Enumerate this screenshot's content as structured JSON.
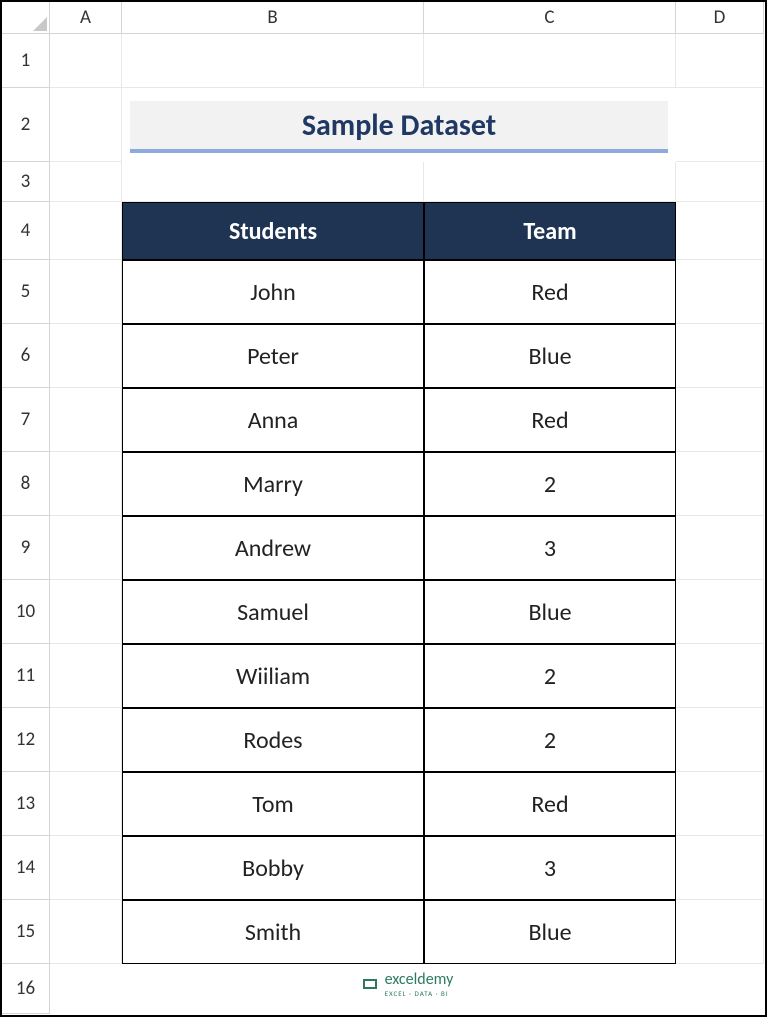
{
  "columns": [
    "A",
    "B",
    "C",
    "D"
  ],
  "rows": [
    "1",
    "2",
    "3",
    "4",
    "5",
    "6",
    "7",
    "8",
    "9",
    "10",
    "11",
    "12",
    "13",
    "14",
    "15",
    "16"
  ],
  "title": "Sample Dataset",
  "table": {
    "headers": [
      "Students",
      "Team"
    ],
    "data": [
      {
        "student": "John",
        "team": "Red"
      },
      {
        "student": "Peter",
        "team": "Blue"
      },
      {
        "student": "Anna",
        "team": "Red"
      },
      {
        "student": "Marry",
        "team": "2"
      },
      {
        "student": "Andrew",
        "team": "3"
      },
      {
        "student": "Samuel",
        "team": "Blue"
      },
      {
        "student": "Wiiliam",
        "team": "2"
      },
      {
        "student": "Rodes",
        "team": "2"
      },
      {
        "student": "Tom",
        "team": "Red"
      },
      {
        "student": "Bobby",
        "team": "3"
      },
      {
        "student": "Smith",
        "team": "Blue"
      }
    ]
  },
  "footer": {
    "name": "exceldemy",
    "sub": "EXCEL · DATA · BI"
  }
}
